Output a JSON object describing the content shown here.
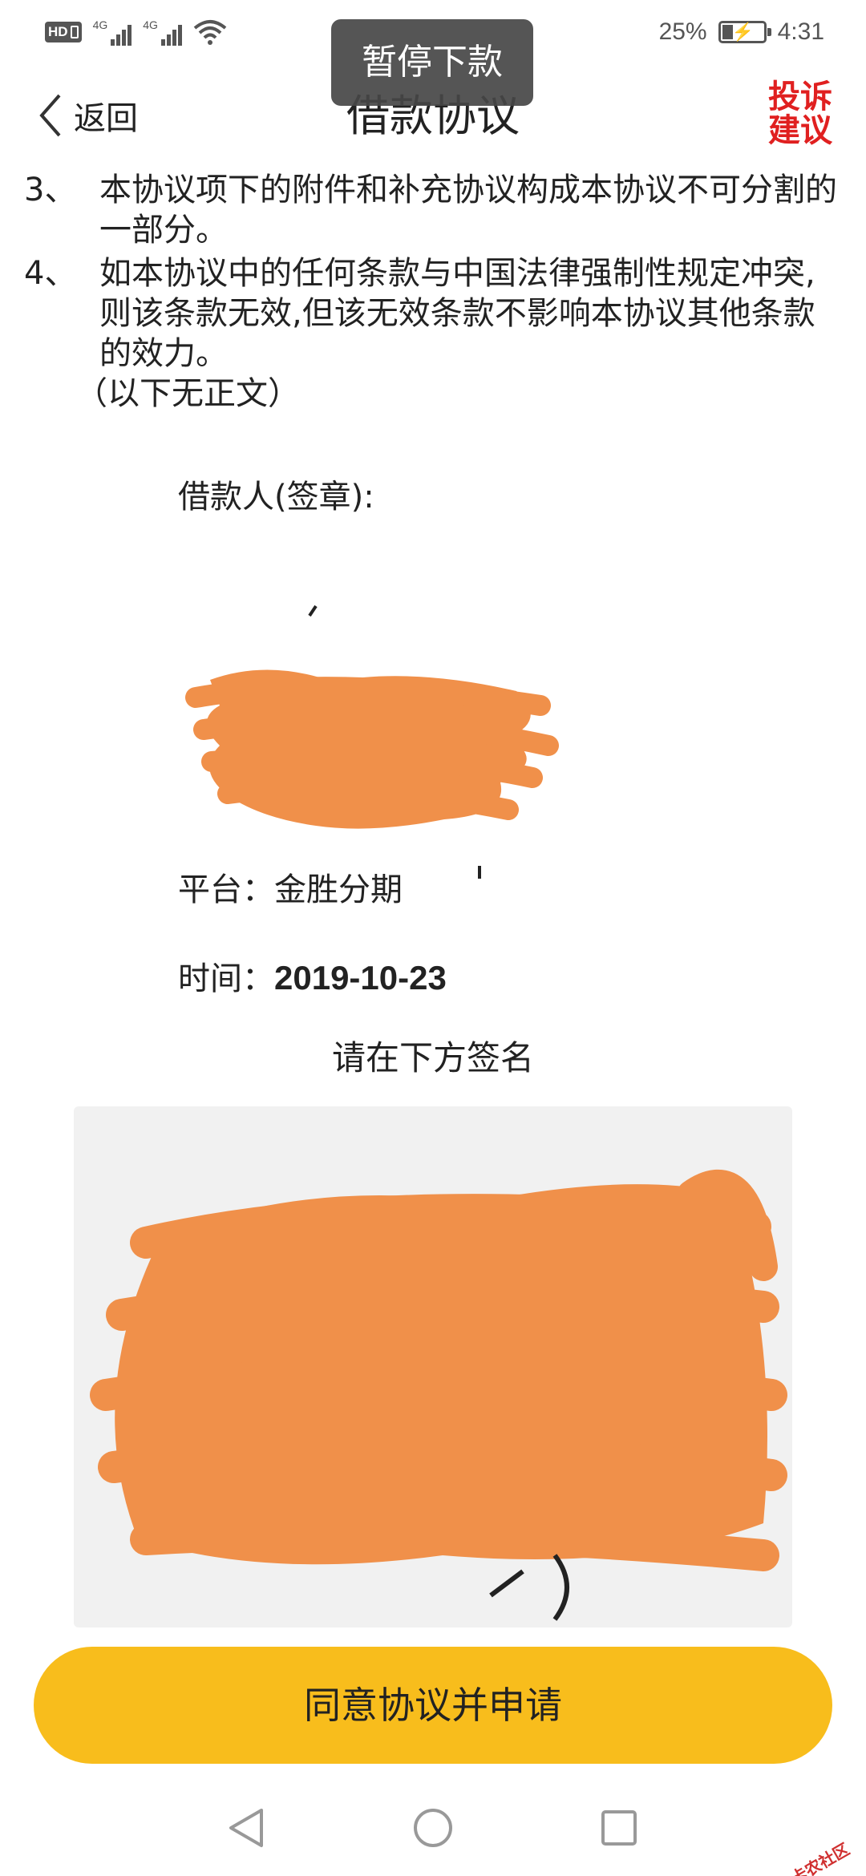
{
  "status_bar": {
    "hd_label": "HD",
    "network1": "4G",
    "network2": "4G",
    "battery_text": "25%",
    "battery_level": 0.25,
    "time": "4:31",
    "icons": [
      "hd-voice-icon",
      "signal-icon",
      "wifi-icon",
      "battery-charging-icon"
    ]
  },
  "header": {
    "back_label": "返回",
    "title": "借款协议",
    "complain_label_line1": "投诉",
    "complain_label_line2": "建议",
    "complain_color": "#e02020"
  },
  "contract": {
    "clauses": [
      {
        "num": "3、",
        "text": "本协议项下的附件和补充协议构成本协议不可分割的一部分。"
      },
      {
        "num": "4、",
        "text": "如本协议中的任何条款与中国法律强制性规定冲突,则该条款无效,但该无效条款不影响本协议其他条款的效力。"
      }
    ],
    "end_note": "（以下无正文）"
  },
  "signature": {
    "signer_label": "借款人(签章):",
    "platform_label": "平台：",
    "platform_value": "金胜分期",
    "time_label": "时间：",
    "time_value": "2019-10-23",
    "sign_hint": "请在下方签名"
  },
  "toast": {
    "text": "暂停下款"
  },
  "submit": {
    "label": "同意协议并申请",
    "color": "#f8bd1c"
  },
  "nav": {
    "icons": [
      "nav-back-icon",
      "nav-home-icon",
      "nav-recent-icon"
    ]
  },
  "watermark": {
    "text": "卡农社区"
  },
  "colors": {
    "scribble": "#f0904a",
    "accent": "#f8bd1c"
  }
}
